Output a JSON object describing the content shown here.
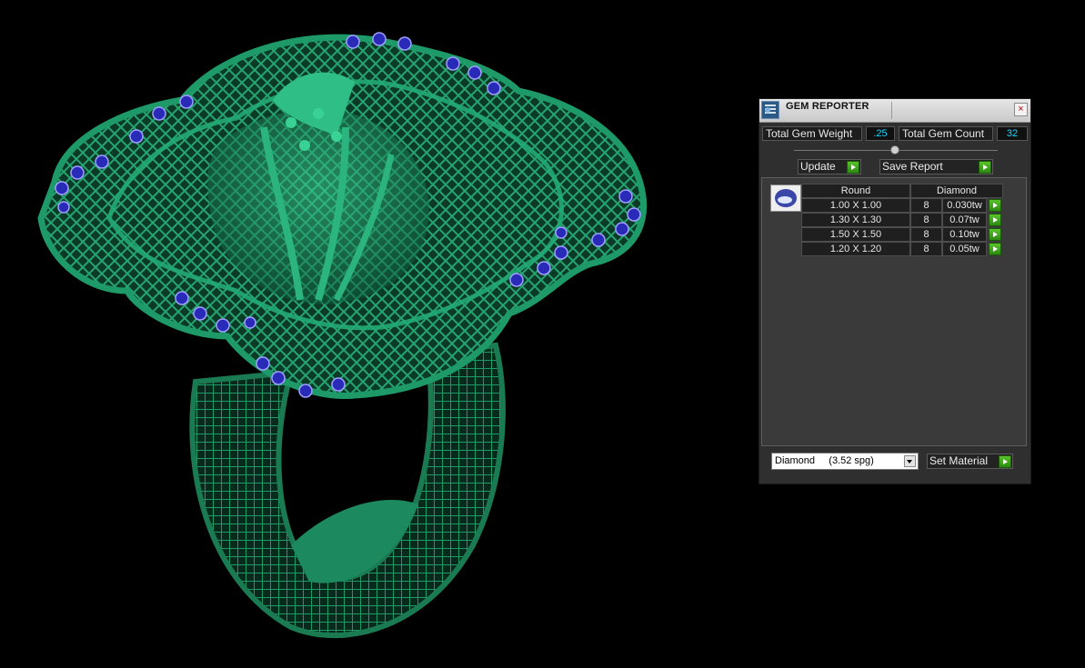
{
  "panel": {
    "title": "GEM REPORTER",
    "close_label": "×",
    "total_weight_label": "Total Gem Weight",
    "total_weight_value": ".25",
    "total_count_label": "Total Gem Count",
    "total_count_value": "32",
    "update_label": "Update",
    "save_report_label": "Save Report",
    "table": {
      "headers": [
        "Round",
        "Diamond"
      ],
      "rows": [
        {
          "size": "1.00 X 1.00",
          "count": "8",
          "weight": "0.030tw"
        },
        {
          "size": "1.30 X 1.30",
          "count": "8",
          "weight": "0.07tw"
        },
        {
          "size": "1.50 X 1.50",
          "count": "8",
          "weight": "0.10tw"
        },
        {
          "size": "1.20 X 1.20",
          "count": "8",
          "weight": "0.05tw"
        }
      ]
    },
    "material_select_value": "Diamond     (3.52 spg)",
    "set_material_label": "Set Material"
  },
  "icons": {
    "title_icon": "gem-report-icon",
    "thumb_icon": "round-gem-icon",
    "go_icon": "green-play-icon"
  },
  "colors": {
    "viewport_bg": "#000000",
    "metal": "#1f8f63",
    "gem": "#2a2ab8",
    "value_text": "#19d8ff",
    "go_button": "#3fae1c"
  }
}
